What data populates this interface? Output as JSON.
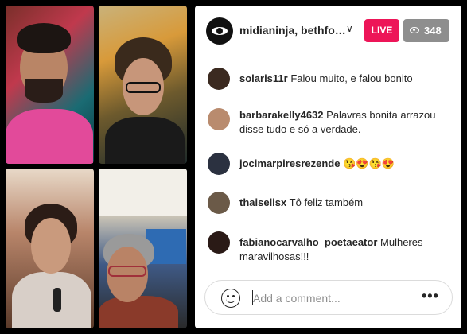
{
  "header": {
    "host_names": "midianinja, bethfo…",
    "chevron": "∨",
    "live_label": "LIVE",
    "viewer_count": "348"
  },
  "comments": [
    {
      "user": "solaris11r",
      "text": "Falou muito, e falou bonito",
      "avatar_color": "#3b2a20"
    },
    {
      "user": "barbarakelly4632",
      "text": "Palavras bonita arrazou disse tudo e só a verdade.",
      "avatar_color": "#b98b6e"
    },
    {
      "user": "jocimarpiresrezende",
      "text": "😘😍😘😍",
      "avatar_color": "#2b3140"
    },
    {
      "user": "thaiselisx",
      "text": "Tô feliz também",
      "avatar_color": "#6b5a48"
    },
    {
      "user": "fabianocarvalho_poetaeator",
      "text": "Mulheres maravilhosas!!!",
      "avatar_color": "#2a1a16"
    }
  ],
  "footer": {
    "placeholder": "Add a comment...",
    "more": "•••"
  },
  "colors": {
    "live": "#ed1558",
    "viewers_badge": "#8e8e8e"
  },
  "icons": [
    "host-avatar-eye-icon",
    "eye-icon",
    "smiley-icon",
    "more-options-icon"
  ]
}
